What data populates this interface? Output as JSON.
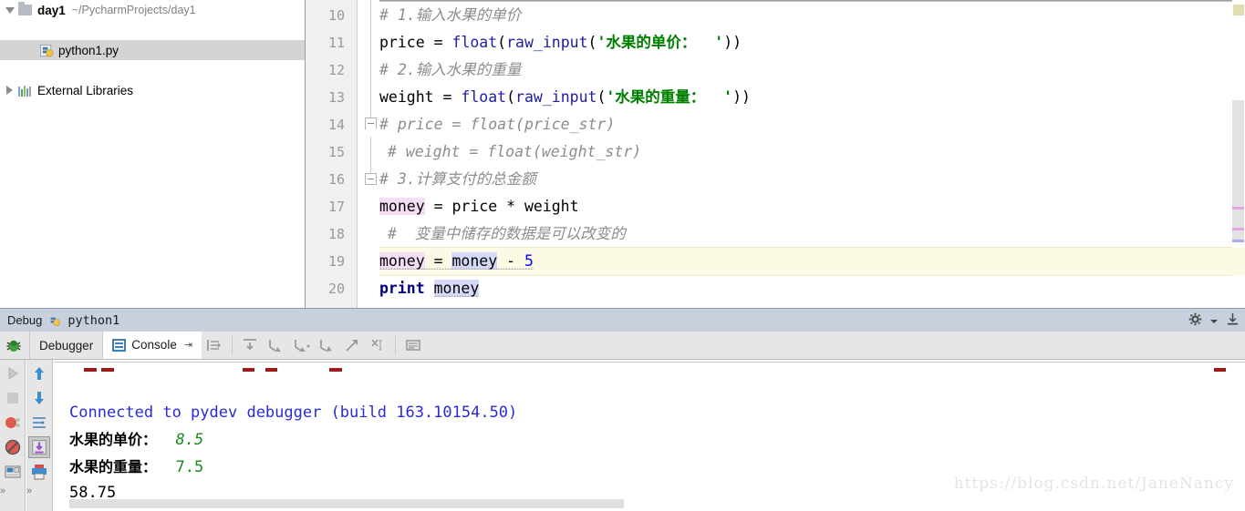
{
  "project_tree": {
    "rows": [
      {
        "twisty": "down",
        "icon": "folder-icon",
        "name": "day1",
        "path": "~/PycharmProjects/day1",
        "selected": false
      },
      {
        "twisty": "blank",
        "icon": "python-file-icon",
        "name": "python1.py",
        "path": "",
        "selected": true
      },
      {
        "twisty": "right",
        "icon": "external-libraries-icon",
        "name": "External Libraries",
        "path": "",
        "selected": false
      }
    ]
  },
  "editor": {
    "line_numbers": [
      "10",
      "11",
      "12",
      "13",
      "14",
      "15",
      "16",
      "17",
      "18",
      "19",
      "20"
    ],
    "current_line": "19",
    "lines": [
      {
        "n": "10",
        "segs": [
          {
            "t": "# 1.输入水果的单价",
            "c": "cmt"
          }
        ]
      },
      {
        "n": "11",
        "segs": [
          {
            "t": "price ",
            "c": "plain"
          },
          {
            "t": "= ",
            "c": "plain"
          },
          {
            "t": "float",
            "c": "fn"
          },
          {
            "t": "(",
            "c": "plain"
          },
          {
            "t": "raw_input",
            "c": "fn"
          },
          {
            "t": "(",
            "c": "plain"
          },
          {
            "t": "'水果的单价：  '",
            "c": "str"
          },
          {
            "t": "))",
            "c": "plain"
          }
        ]
      },
      {
        "n": "12",
        "segs": [
          {
            "t": "# 2.输入水果的重量",
            "c": "cmt"
          }
        ]
      },
      {
        "n": "13",
        "segs": [
          {
            "t": "weight ",
            "c": "plain"
          },
          {
            "t": "= ",
            "c": "plain"
          },
          {
            "t": "float",
            "c": "fn"
          },
          {
            "t": "(",
            "c": "plain"
          },
          {
            "t": "raw_input",
            "c": "fn"
          },
          {
            "t": "(",
            "c": "plain"
          },
          {
            "t": "'水果的重量：  '",
            "c": "str"
          },
          {
            "t": "))",
            "c": "plain"
          }
        ]
      },
      {
        "n": "14",
        "segs": [
          {
            "t": "# price = float(price_str)",
            "c": "cmt"
          }
        ]
      },
      {
        "n": "15",
        "segs": [
          {
            "t": "# weight = float(weight_str)",
            "c": "cmt"
          }
        ]
      },
      {
        "n": "16",
        "segs": [
          {
            "t": "# 3.计算支付的总金额",
            "c": "cmt"
          }
        ]
      },
      {
        "n": "17",
        "segs": [
          {
            "t": "money",
            "c": "plain hl-w"
          },
          {
            "t": " = price * weight",
            "c": "plain"
          }
        ]
      },
      {
        "n": "18",
        "segs": [
          {
            "t": "#  变量中储存的数据是可以改变的",
            "c": "cmt"
          }
        ]
      },
      {
        "n": "19",
        "segs": [
          {
            "t": "money",
            "c": "plain hl-w"
          },
          {
            "t": " = ",
            "c": "plain"
          },
          {
            "t": "money",
            "c": "plain hl-r"
          },
          {
            "t": " - ",
            "c": "plain"
          },
          {
            "t": "5",
            "c": "num"
          }
        ]
      },
      {
        "n": "20",
        "segs": [
          {
            "t": "print",
            "c": "kw"
          },
          {
            "t": " ",
            "c": "plain"
          },
          {
            "t": "money",
            "c": "plain hl-r"
          }
        ]
      }
    ]
  },
  "debug_panel": {
    "title": "Debug",
    "run_config_name": "python1",
    "tabs": [
      {
        "label": "Debugger",
        "icon": "debugger-icon",
        "active": false
      },
      {
        "label": "Console",
        "icon": "console-icon",
        "active": true
      }
    ],
    "pin_glyph": "⇥",
    "step_buttons": [
      "show-execution-point-icon",
      "step-over-icon",
      "step-into-icon",
      "force-step-into-icon",
      "step-out-icon",
      "run-to-cursor-icon",
      "evaluate-expression-icon"
    ],
    "extra_button": "view-breakpoints-icon",
    "title_bar_buttons": [
      "settings-gear-icon",
      "hide-panel-icon"
    ],
    "left_toolbar": [
      "rerun-icon",
      "stop-icon",
      "view-breakpoints-icon",
      "mute-breakpoints-icon",
      "restore-layout-icon"
    ],
    "left_toolbar2": [
      "scroll-up-icon",
      "scroll-down-icon",
      "soft-wrap-icon",
      "scroll-to-end-icon",
      "print-icon"
    ],
    "overflow_glyph": "»"
  },
  "console": {
    "lines": [
      {
        "segs": [
          {
            "t": "Connected to pydev debugger (build 163.10154.50)",
            "c": "c-blue"
          }
        ]
      },
      {
        "segs": [
          {
            "t": "水果的单价：",
            "c": "c-cjk"
          },
          {
            "t": "  8.5",
            "c": "c-greeni"
          }
        ]
      },
      {
        "segs": [
          {
            "t": "水果的重量：",
            "c": "c-cjk"
          },
          {
            "t": "  7.5",
            "c": "c-green"
          }
        ]
      },
      {
        "segs": [
          {
            "t": "58.75",
            "c": "c-black"
          }
        ]
      }
    ]
  },
  "watermark": "https://blog.csdn.net/JaneNancy",
  "colors": {
    "comment": "#8c8c8c",
    "string": "#008000",
    "function": "#20209f",
    "number": "#0000ff",
    "keyword": "#000080",
    "current_line_bg": "#fcf9e4",
    "write_usage_bg": "#f6ddf6",
    "read_usage_bg": "#d4d9f7",
    "debug_title_bg": "#c8d0de",
    "console_connected": "#2b2bd4",
    "console_value": "#1a8a1a"
  }
}
